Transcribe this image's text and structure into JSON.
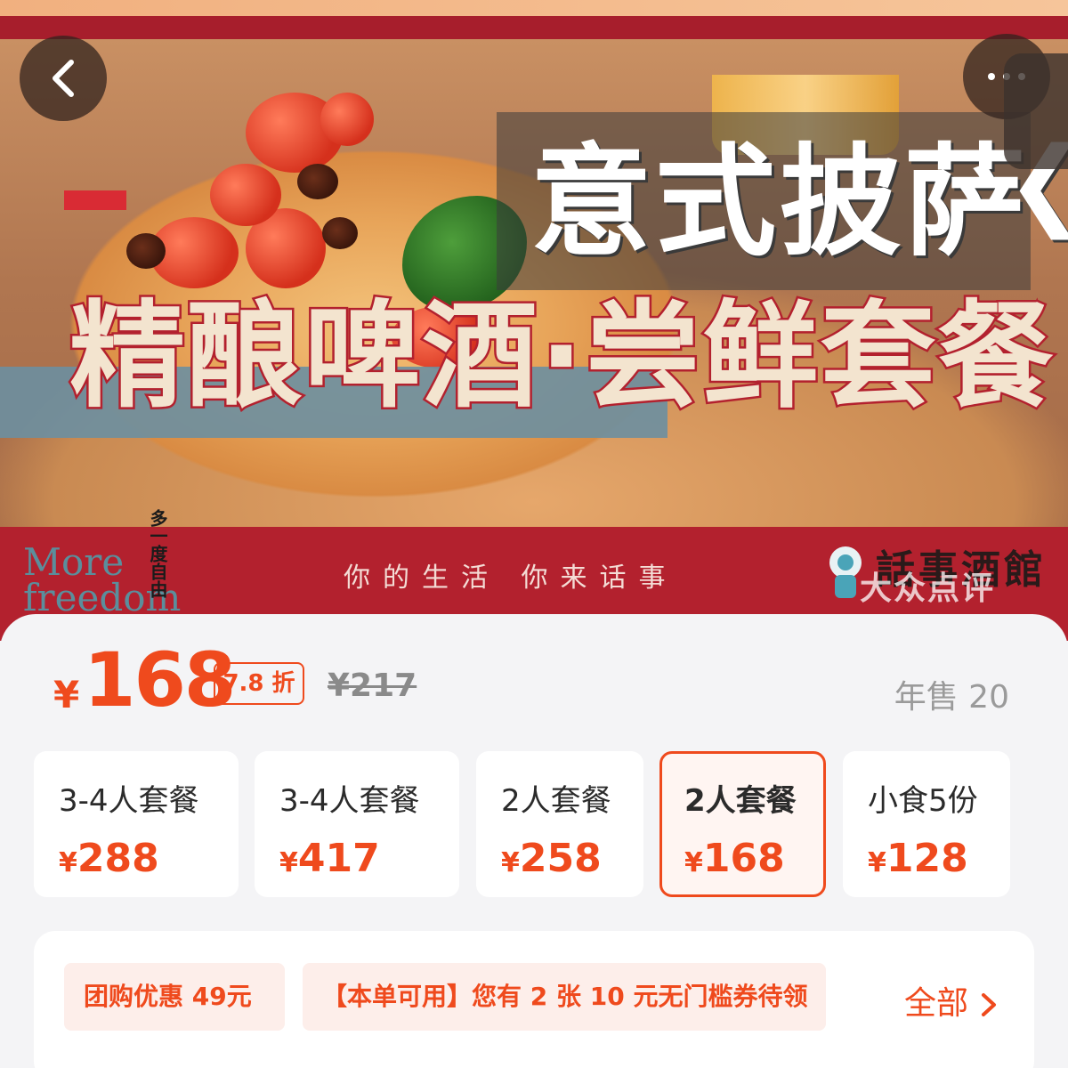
{
  "hero": {
    "title_italian": "意式披萨",
    "title_main": "精酿啤酒·尝鲜套餐",
    "brand_en": "More freedom",
    "brand_cn": "多一度自由",
    "slogan": "你的生活  你来话事",
    "shop_name": "話事酒館",
    "watermark": "大众点评",
    "chevron": "❮"
  },
  "price": {
    "currency": "¥",
    "current": "168",
    "discount": "7.8 折",
    "original": "¥217",
    "sold": "年售 20"
  },
  "skus": [
    {
      "name": "3-4人套餐",
      "currency": "¥",
      "price": "288",
      "selected": false
    },
    {
      "name": "3-4人套餐",
      "currency": "¥",
      "price": "417",
      "selected": false
    },
    {
      "name": "2人套餐",
      "currency": "¥",
      "price": "258",
      "selected": false
    },
    {
      "name": "2人套餐",
      "currency": "¥",
      "price": "168",
      "selected": true
    },
    {
      "name": "小食5份",
      "currency": "¥",
      "price": "128",
      "selected": false
    }
  ],
  "promo": {
    "group_discount": "团购优惠 49元",
    "coupon": "【本单可用】您有 2 张 10 元无门槛券待领",
    "all_link": "全部"
  },
  "colors": {
    "accent": "#ef4a1d",
    "banner_red": "#b3212e",
    "background": "#f4f4f6"
  },
  "icons": [
    "back-arrow-icon",
    "more-dots-icon",
    "chevron-right-icon",
    "brand-logo-icon"
  ]
}
